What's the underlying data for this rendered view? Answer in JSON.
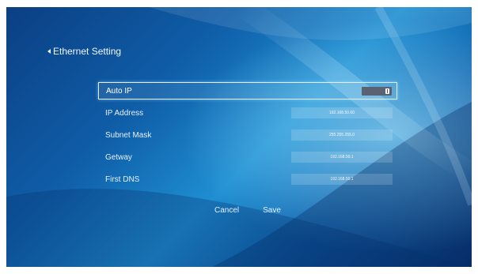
{
  "header": {
    "back_label": "Ethernet Setting"
  },
  "settings": {
    "rows": [
      {
        "label": "Auto IP",
        "value": "",
        "control": "toggle",
        "toggle_on": true,
        "focused": true
      },
      {
        "label": "IP Address",
        "value": "192.168.50.60",
        "control": "field"
      },
      {
        "label": "Subnet Mask",
        "value": "255.255.255.0",
        "control": "field"
      },
      {
        "label": "Getway",
        "value": "192.168.50.1",
        "control": "field"
      },
      {
        "label": "First DNS",
        "value": "192.168.50.1",
        "control": "field"
      }
    ]
  },
  "actions": {
    "cancel_label": "Cancel",
    "save_label": "Save"
  },
  "colors": {
    "accent": "#dfeeff",
    "background": "#0f5ea8"
  },
  "icons": {
    "back": "chevron-left-icon"
  }
}
